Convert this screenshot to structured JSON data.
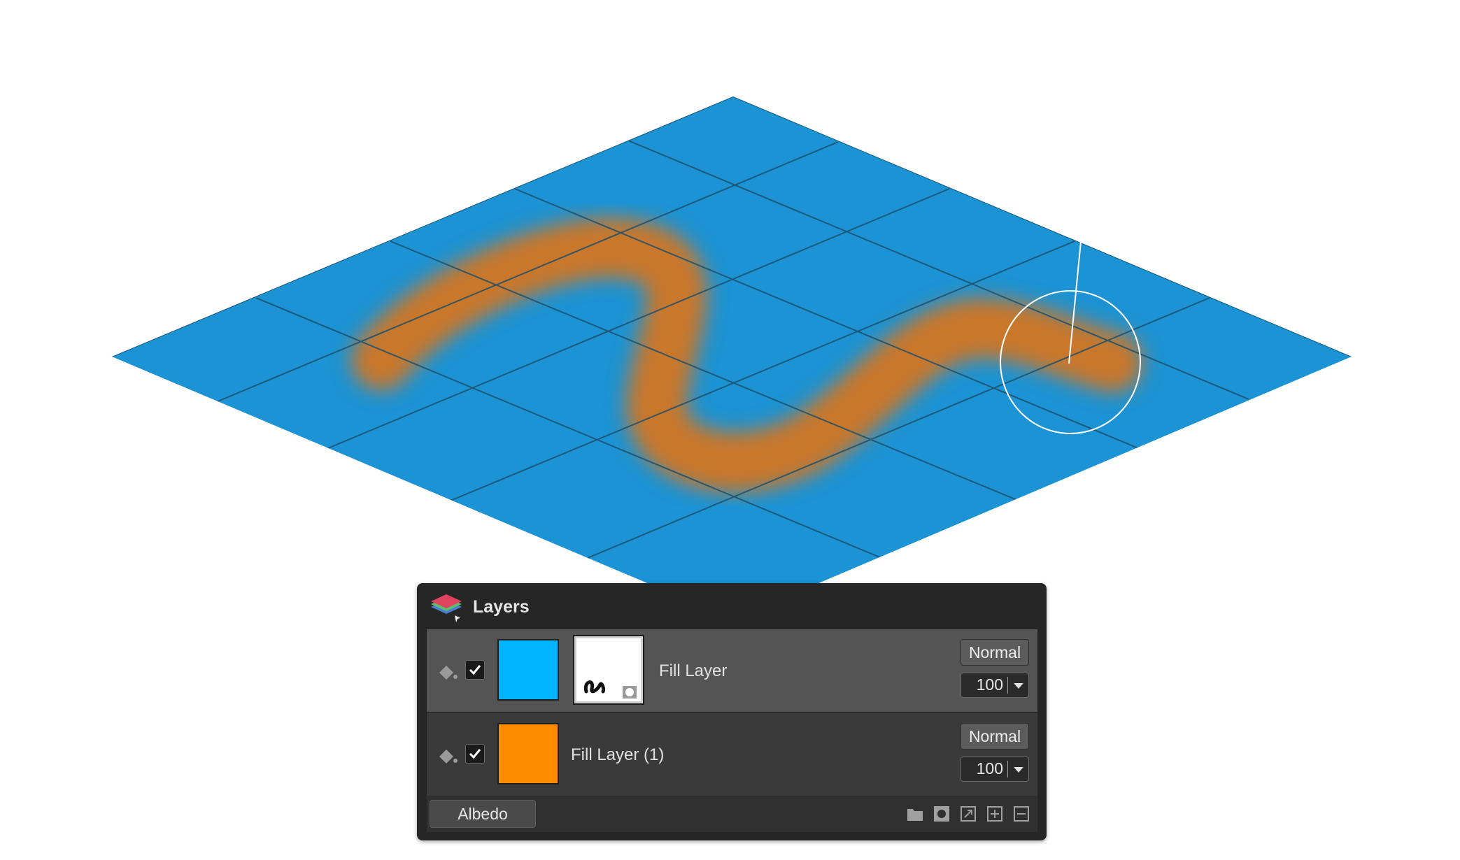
{
  "panel": {
    "title": "Layers",
    "layers": [
      {
        "name": "Fill Layer",
        "color": "#00b4ff",
        "visible": true,
        "has_mask": true,
        "selected": true,
        "blend_mode": "Normal",
        "opacity": "100"
      },
      {
        "name": "Fill Layer (1)",
        "color": "#ff8c00",
        "visible": true,
        "has_mask": false,
        "selected": false,
        "blend_mode": "Normal",
        "opacity": "100"
      }
    ],
    "footer": {
      "channel": "Albedo",
      "icons": [
        "folder-icon",
        "mask-icon",
        "resize-icon",
        "add-layer-icon",
        "remove-layer-icon"
      ]
    }
  },
  "viewport": {
    "plane_color": "#1b93d4",
    "paint_color": "#c9772b",
    "grid_line_color": "#1d4f6b",
    "brush_cursor_color": "#ffffff"
  }
}
